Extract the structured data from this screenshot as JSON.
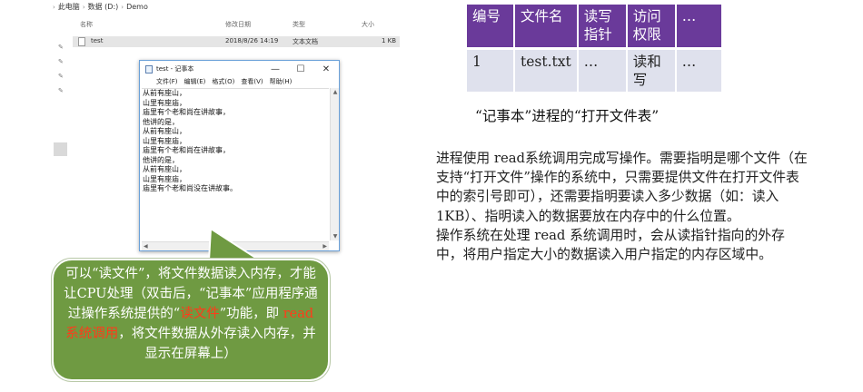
{
  "explorer": {
    "breadcrumb": [
      "此电脑",
      "数据 (D:)",
      "Demo"
    ],
    "columns": [
      "名称",
      "修改日期",
      "类型",
      "大小"
    ],
    "file": {
      "name": "test",
      "modified": "2018/8/26 14:19",
      "type": "文本文档",
      "size": "1 KB"
    }
  },
  "notepad": {
    "title": "test - 记事本",
    "menu": [
      "文件(F)",
      "编辑(E)",
      "格式(O)",
      "查看(V)",
      "帮助(H)"
    ],
    "lines": [
      "从前有座山，",
      "山里有座庙，",
      "庙里有个老和尚在讲故事，",
      "他讲的是，",
      "从前有座山，",
      "山里有座庙，",
      "庙里有个老和尚在讲故事，",
      "他讲的是，",
      "从前有座山，",
      "山里有座庙，",
      "庙里有个老和尚没在讲故事。"
    ]
  },
  "callout": {
    "text_1": "可以“读文件”，将文件数据读入内存，才能让CPU处理（双击后，“记事本”应用程序通过操作系统提供的“",
    "highlight_1": "读文件",
    "text_2": "”功能，即 ",
    "highlight_2": "read 系统调用",
    "text_3": "，将文件数据从外存读入内存，并显示在屏幕上）",
    "fill_color": "#6f9a42",
    "highlight_color": "#ff3b1a"
  },
  "table": {
    "headers": [
      "编号",
      "文件名",
      "读写指针",
      "访问权限",
      "…"
    ],
    "row": [
      "1",
      "test.txt",
      "…",
      "读和写",
      "…"
    ],
    "header_color": "#6a3a9a",
    "row_color": "#dfe1ed",
    "caption": "“记事本”进程的“打开文件表”"
  },
  "paragraph": {
    "p1": "进程使用 read系统调用完成写操作。需要指明是哪个文件（在支持“打开文件”操作的系统中，只需要提供文件在打开文件表中的索引号即可），还需要指明要读入多少数据（如：读入 1KB）、指明读入的数据要放在内存中的什么位置。",
    "p2": "操作系统在处理 read 系统调用时，会从读指针指向的外存中，将用户指定大小的数据读入用户指定的内存区域中。"
  }
}
